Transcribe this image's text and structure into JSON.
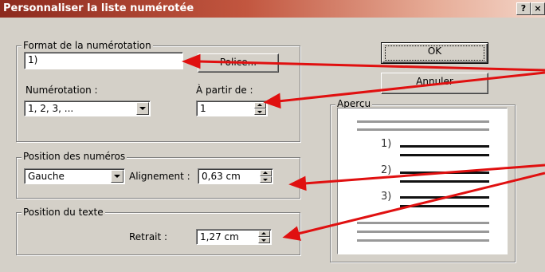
{
  "dialog": {
    "title": "Personnaliser la liste numérotée",
    "help_btn": "?",
    "close_btn": "×"
  },
  "format": {
    "group_label": "Format de la numérotation",
    "value": "1)",
    "police_button": "Police...",
    "numerotation_label": "Numérotation :",
    "numerotation_value": "1, 2, 3, ...",
    "partir_label": "À partir de :",
    "partir_value": "1"
  },
  "buttons": {
    "ok": "OK",
    "annuler": "Annuler"
  },
  "apercu": {
    "label": "Aperçu",
    "numbers": [
      "1)",
      "2)",
      "3)"
    ]
  },
  "position_numeros": {
    "group_label": "Position des numéros",
    "align_value": "Gauche",
    "alignement_label": "Alignement :",
    "alignement_value": "0,63 cm"
  },
  "position_texte": {
    "group_label": "Position du texte",
    "retrait_label": "Retrait :",
    "retrait_value": "1,27 cm"
  },
  "colors": {
    "title_gradient_start": "#8c2a1e",
    "dialog_bg": "#d4d0c8",
    "arrow": "#e01010"
  }
}
